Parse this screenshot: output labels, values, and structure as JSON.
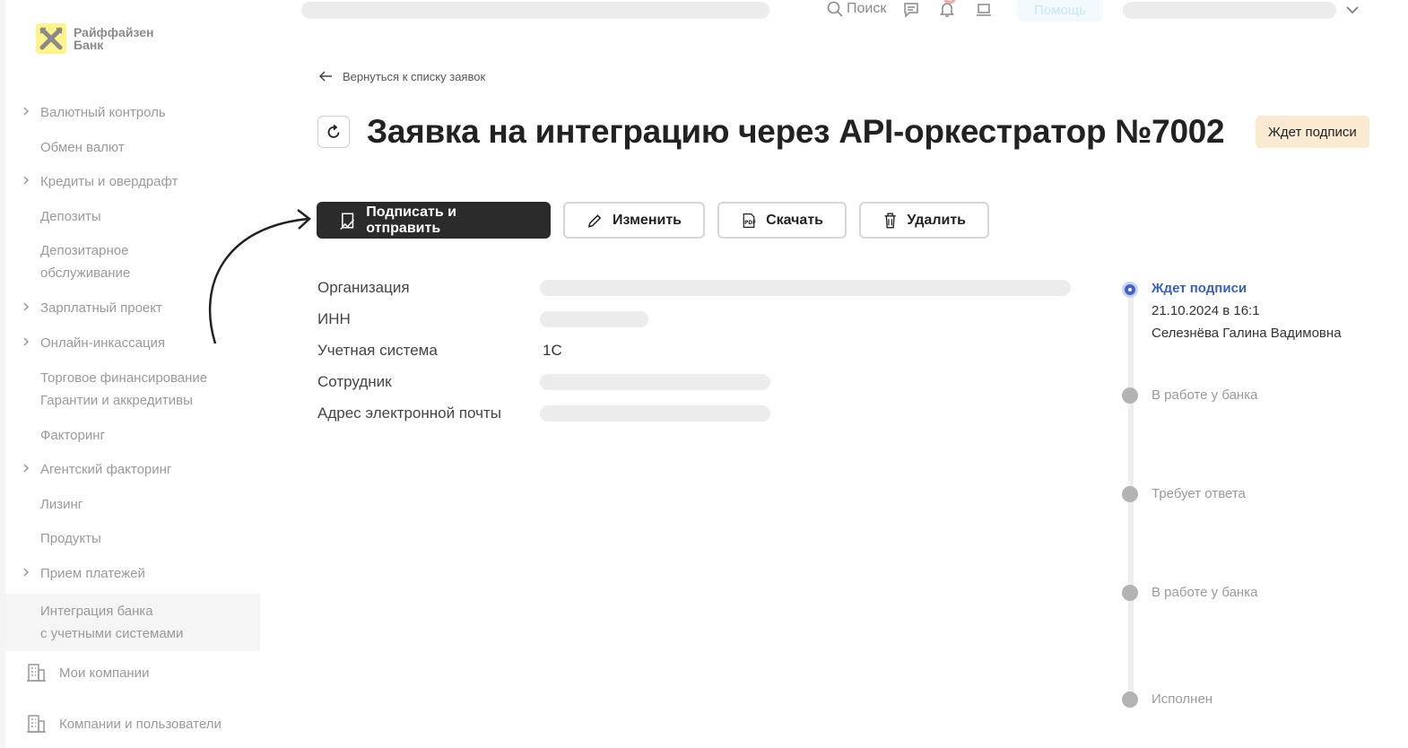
{
  "sidebar": {
    "logo_text": "Райффайзен\nБанк",
    "items": [
      {
        "label": "Валютный контроль",
        "chevron": true
      },
      {
        "label": "Обмен валют",
        "chevron": false
      },
      {
        "label": "Кредиты и овердрафт",
        "chevron": true
      },
      {
        "label": "Депозиты",
        "chevron": false
      },
      {
        "label": "Депозитарное\nобслуживание",
        "chevron": false
      },
      {
        "label": "Зарплатный проект",
        "chevron": true
      },
      {
        "label": "Онлайн-инкассация",
        "chevron": true
      },
      {
        "label": "Торговое финансирование\nГарантии и аккредитивы",
        "chevron": false
      },
      {
        "label": "Факторинг",
        "chevron": false
      },
      {
        "label": "Агентский факторинг",
        "chevron": true
      },
      {
        "label": "Лизинг",
        "chevron": false
      },
      {
        "label": "Продукты",
        "chevron": false
      },
      {
        "label": "Прием платежей",
        "chevron": true
      },
      {
        "label": "Интеграция банка\nс учетными системами",
        "chevron": false,
        "active": true
      }
    ],
    "bottom_items": [
      {
        "label": "Мои компании",
        "icon": "building-icon"
      },
      {
        "label": "Компании и пользователи",
        "icon": "building-icon"
      }
    ]
  },
  "topbar": {
    "search_label": "Поиск",
    "help_label": "Помощь",
    "notification_count": "1"
  },
  "main": {
    "back_link": "Вернуться к списку заявок",
    "title": "Заявка на интеграцию через API-оркестратор №7002",
    "status_badge": "Ждет подписи",
    "actions": {
      "sign_send": "Подписать и отправить",
      "edit": "Изменить",
      "download": "Скачать",
      "delete": "Удалить"
    },
    "fields": [
      {
        "label": "Организация",
        "value": ""
      },
      {
        "label": "ИНН",
        "value": ""
      },
      {
        "label": "Учетная система",
        "value": "1С"
      },
      {
        "label": "Сотрудник",
        "value": ""
      },
      {
        "label": "Адрес электронной почты",
        "value": ""
      }
    ]
  },
  "timeline": {
    "steps": [
      {
        "label": "Ждет подписи",
        "date": "21.10.2024 в 16:1",
        "person": "Селезнёва Галина Вадимовна",
        "active": true
      },
      {
        "label": "В работе у банка"
      },
      {
        "label": "Требует ответа"
      },
      {
        "label": "В работе у банка"
      },
      {
        "label": "Исполнен"
      }
    ]
  },
  "colors": {
    "active_blue": "#3a5fc2",
    "primary_button": "#2b2b2b",
    "badge_bg": "#fbead2",
    "logo_yellow": "#fff38a"
  }
}
